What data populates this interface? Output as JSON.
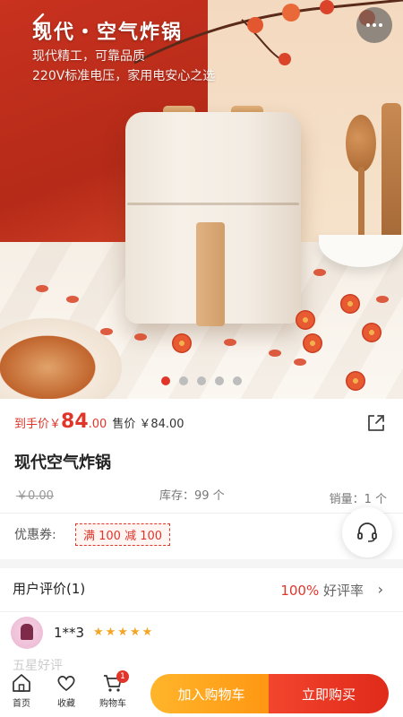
{
  "hero": {
    "title": "现代・空气炸锅",
    "subtitle_1": "现代精工，可靠品质",
    "subtitle_2": "220V标准电压，家用电安心之选",
    "carousel": {
      "count": 5,
      "active_index": 0
    }
  },
  "price": {
    "hand_label": "到手价",
    "currency": "￥",
    "hand_integer": "84",
    "hand_decimal": ".00",
    "sale_label": "售价",
    "sale_value": "￥84.00"
  },
  "product": {
    "name": "现代空气炸锅",
    "original_price": "￥0.00",
    "stock": "库存：99 个",
    "sold": "销量：1 个"
  },
  "coupon": {
    "label": "优惠券:",
    "tag": "满 100 减 100"
  },
  "reviews": {
    "title": "用户评价(1)",
    "rate_pct": "100%",
    "rate_label": " 好评率",
    "chevron": "›",
    "items": [
      {
        "name": "1**3",
        "stars": "★★★★★",
        "text": "五星好评"
      }
    ]
  },
  "bottom_bar": {
    "home_label": "首页",
    "fav_label": "收藏",
    "cart_label": "购物车",
    "cart_count": "1",
    "add_cart_label": "加入购物车",
    "buy_now_label": "立即购买"
  },
  "colors": {
    "accent_red": "#e0362a",
    "accent_orange": "#ff9612",
    "star": "#f5a524"
  }
}
